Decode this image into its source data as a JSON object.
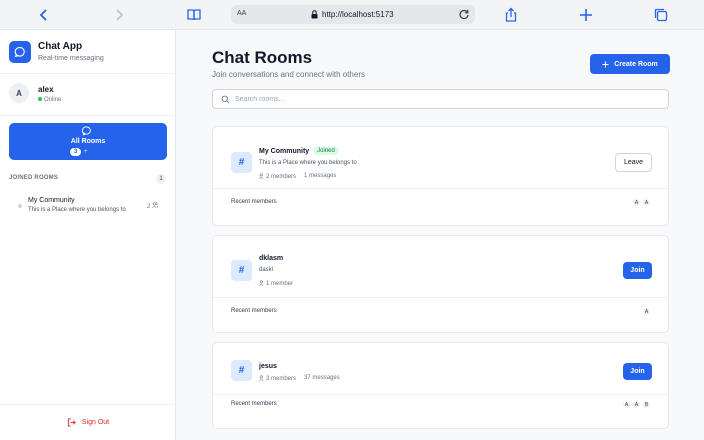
{
  "browser": {
    "text_size_label": "AA",
    "url": "http://localhost:5173"
  },
  "sidebar": {
    "app_title": "Chat App",
    "app_subtitle": "Real-time messaging",
    "user": {
      "initial": "A",
      "name": "alex",
      "status": "Online"
    },
    "all_rooms": {
      "label": "All Rooms",
      "count": "3",
      "plus": "+"
    },
    "joined_heading": "JOINED ROOMS",
    "joined_count": "1",
    "joined_rooms": [
      {
        "name": "My Community",
        "description": "This is a Place where you belongs to",
        "members": "2"
      }
    ],
    "sign_out_label": "Sign Out"
  },
  "main": {
    "title": "Chat Rooms",
    "subtitle": "Join conversations and connect with others",
    "create_label": "Create Room",
    "search_placeholder": "Search rooms...",
    "rooms": [
      {
        "name": "My Community",
        "joined_tag": "Joined",
        "description": "This is a Place where you belongs to",
        "members": "2 members",
        "messages": "1 messages",
        "action": "Leave",
        "recent_label": "Recent members",
        "recent": [
          "A",
          "A"
        ]
      },
      {
        "name": "dklasm",
        "description": "daskl",
        "members": "1 member",
        "action": "Join",
        "recent_label": "Recent members",
        "recent": [
          "A"
        ]
      },
      {
        "name": "jesus",
        "members": "3 members",
        "messages": "37 messages",
        "action": "Join",
        "recent_label": "Recent members",
        "recent": [
          "A",
          "A",
          "B"
        ]
      }
    ]
  },
  "colors": {
    "accent": "#2563eb",
    "online": "#22c55e",
    "danger": "#dc2626",
    "joined_bg": "#dcfce7",
    "joined_text": "#15803d"
  }
}
